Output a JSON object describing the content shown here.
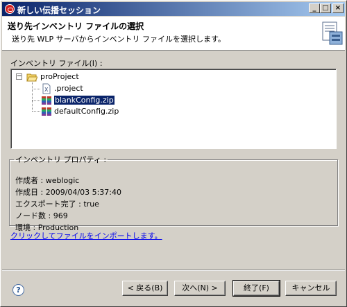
{
  "window": {
    "title": "新しい伝播セッション",
    "controls": {
      "minimize": "_",
      "maximize": "□",
      "close": "×"
    }
  },
  "header": {
    "title": "送り先インベントリ ファイルの選択",
    "subtitle": "送り先 WLP サーバからインベントリ ファイルを選択します。"
  },
  "inventory": {
    "label": "インベントリ ファイル(I) :",
    "tree": {
      "root": {
        "label": "proProject",
        "expanded": true,
        "icon": "folder-open-icon"
      },
      "children": [
        {
          "label": ".project",
          "icon": "file-icon",
          "selected": false
        },
        {
          "label": "blankConfig.zip",
          "icon": "zip-archive-icon",
          "selected": true
        },
        {
          "label": "defaultConfig.zip",
          "icon": "zip-archive-icon",
          "selected": false
        }
      ]
    }
  },
  "properties": {
    "legend": "インベントリ プロパティ :",
    "rows": [
      "作成者 : weblogic",
      "作成日 : 2009/04/03 5:37:40",
      "エクスポート完了 : true",
      "ノード数 : 969",
      "環境 : Production"
    ]
  },
  "import_link": "クリックしてファイルをインポートします。",
  "buttons": {
    "help": "?",
    "back": "< 戻る(B)",
    "next": "次へ(N) >",
    "finish": "終了(F)",
    "cancel": "キャンセル"
  },
  "colors": {
    "selection": "#0a246a",
    "link": "#0000ee",
    "titlebar_start": "#0a246a",
    "titlebar_end": "#a6caf0"
  }
}
